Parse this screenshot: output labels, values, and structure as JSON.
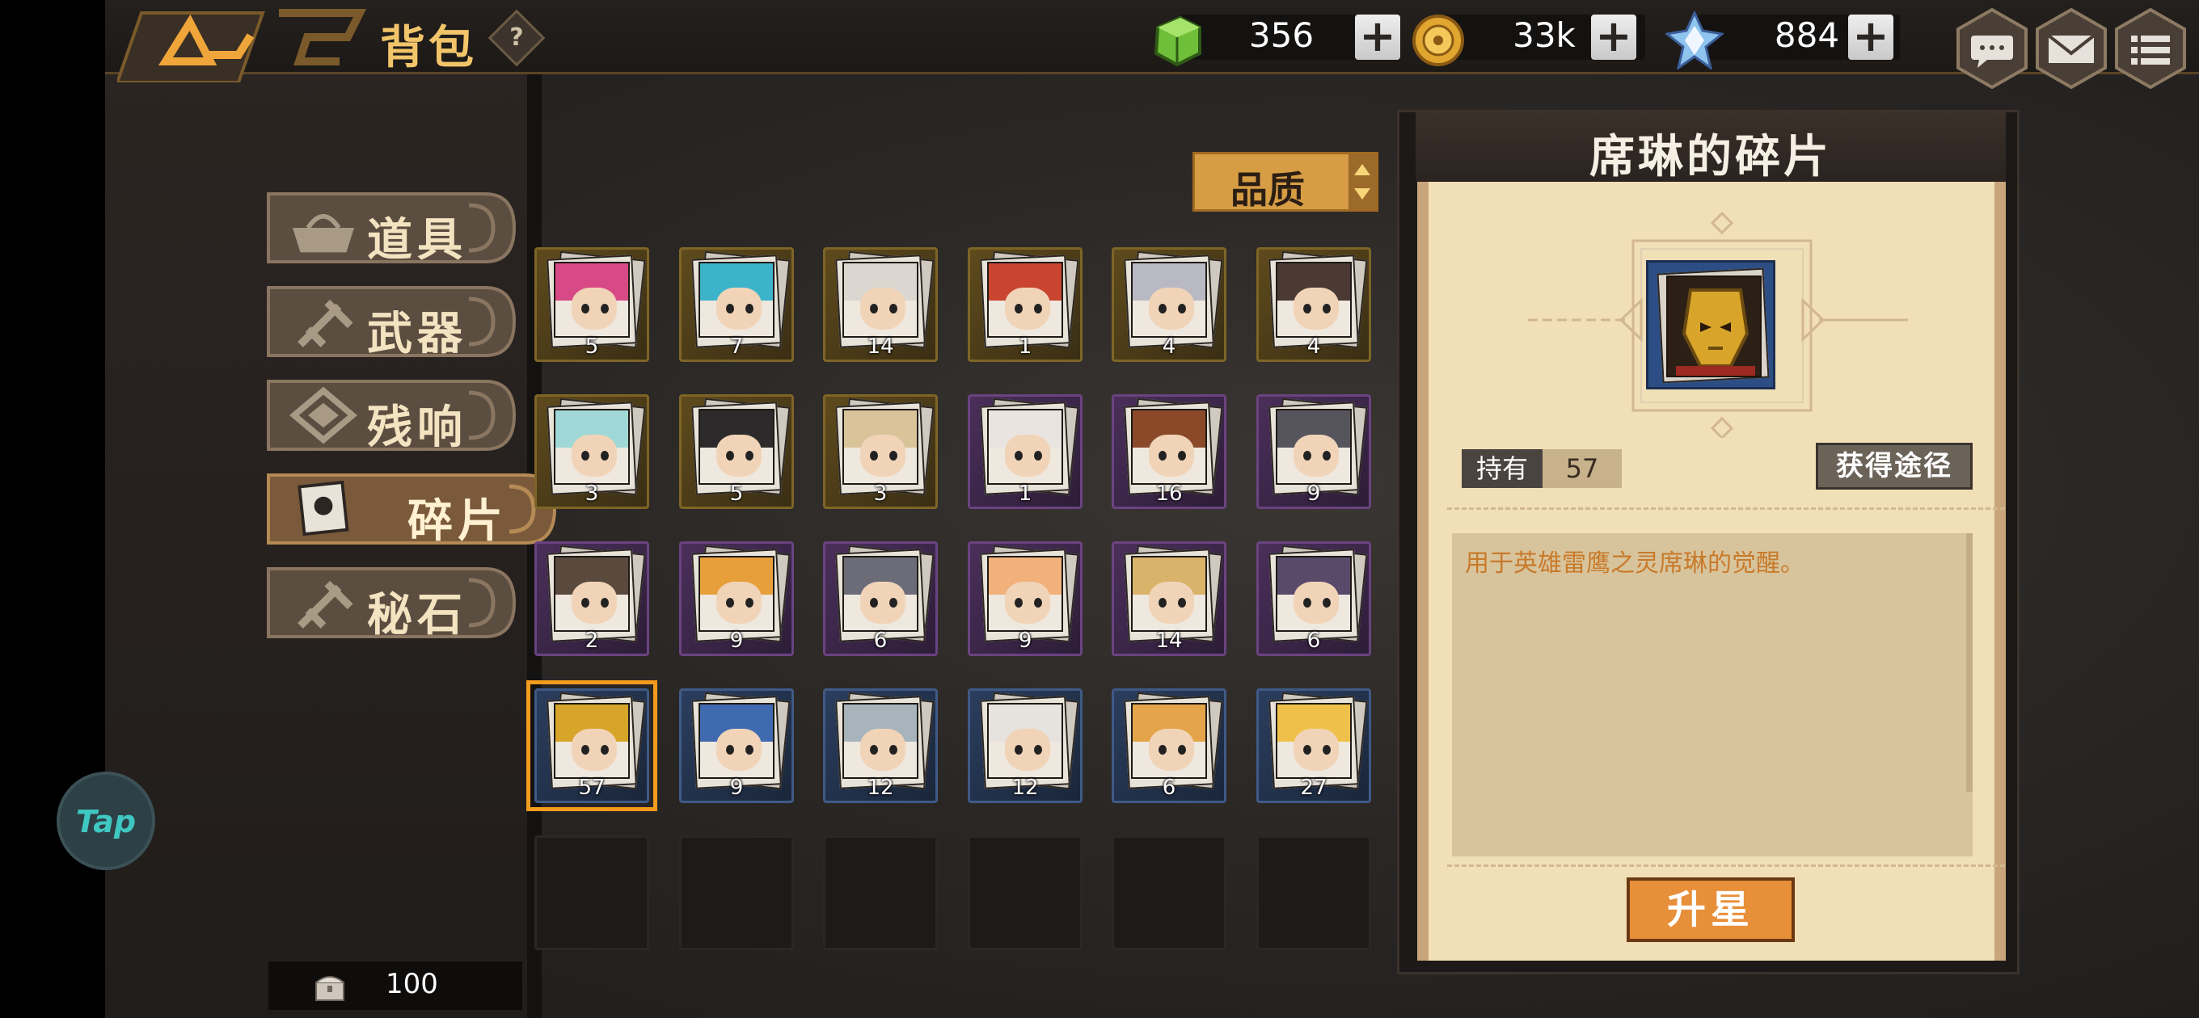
{
  "header": {
    "title": "背包",
    "help_glyph": "?",
    "currencies": [
      {
        "name": "green-crystal-icon",
        "value": "356"
      },
      {
        "name": "gold-coin-icon",
        "value": "33k"
      },
      {
        "name": "diamond-icon",
        "value": "884"
      }
    ],
    "plus_glyph": "+"
  },
  "tabs": [
    {
      "label": "道具",
      "icon": "basket-icon"
    },
    {
      "label": "武器",
      "icon": "weapon-icon"
    },
    {
      "label": "残响",
      "icon": "echo-icon"
    },
    {
      "label": "碎片",
      "icon": "fragment-icon",
      "active": true
    },
    {
      "label": "秘石",
      "icon": "stone-icon"
    }
  ],
  "bag_count": "100",
  "tap_label": "Tap",
  "sort": {
    "label": "品质"
  },
  "grid": [
    {
      "rarity": "gold",
      "count": "5",
      "hair": "#d84a86"
    },
    {
      "rarity": "gold",
      "count": "7",
      "hair": "#3cb3c9"
    },
    {
      "rarity": "gold",
      "count": "14",
      "hair": "#dcd6d0"
    },
    {
      "rarity": "gold",
      "count": "1",
      "hair": "#c9452f"
    },
    {
      "rarity": "gold",
      "count": "4",
      "hair": "#b9b9c4"
    },
    {
      "rarity": "gold",
      "count": "4",
      "hair": "#4a3a33"
    },
    {
      "rarity": "gold",
      "count": "3",
      "hair": "#9fd8d6"
    },
    {
      "rarity": "gold",
      "count": "5",
      "hair": "#2d2a2b"
    },
    {
      "rarity": "gold",
      "count": "3",
      "hair": "#d9c49a"
    },
    {
      "rarity": "purple",
      "count": "1",
      "hair": "#e9e4e0"
    },
    {
      "rarity": "purple",
      "count": "16",
      "hair": "#8a4a2a"
    },
    {
      "rarity": "purple",
      "count": "9",
      "hair": "#56545c"
    },
    {
      "rarity": "purple",
      "count": "2",
      "hair": "#5a4a3e"
    },
    {
      "rarity": "purple",
      "count": "9",
      "hair": "#e79f3b"
    },
    {
      "rarity": "purple",
      "count": "6",
      "hair": "#6b6c78"
    },
    {
      "rarity": "purple",
      "count": "9",
      "hair": "#f2b07a"
    },
    {
      "rarity": "purple",
      "count": "14",
      "hair": "#d9b36a"
    },
    {
      "rarity": "purple",
      "count": "6",
      "hair": "#5a4a6a"
    },
    {
      "rarity": "blue",
      "count": "57",
      "hair": "#d7a52a",
      "selected": true
    },
    {
      "rarity": "blue",
      "count": "9",
      "hair": "#3f6ab0"
    },
    {
      "rarity": "blue",
      "count": "12",
      "hair": "#a8b4bc"
    },
    {
      "rarity": "blue",
      "count": "12",
      "hair": "#e6e2de"
    },
    {
      "rarity": "blue",
      "count": "6",
      "hair": "#e4a44a"
    },
    {
      "rarity": "blue",
      "count": "27",
      "hair": "#f0c14a"
    },
    {
      "rarity": "empty"
    },
    {
      "rarity": "empty"
    },
    {
      "rarity": "empty"
    },
    {
      "rarity": "empty"
    },
    {
      "rarity": "empty"
    },
    {
      "rarity": "empty"
    }
  ],
  "detail": {
    "title": "席琳的碎片",
    "owned_label": "持有",
    "owned_value": "57",
    "source_button": "获得途径",
    "description": "用于英雄雷鹰之灵席琳的觉醒。",
    "upgrade_button": "升星"
  },
  "colors": {
    "accent": "#f2c56a",
    "selection": "#f29b1d",
    "upgrade": "#e88f3a"
  }
}
